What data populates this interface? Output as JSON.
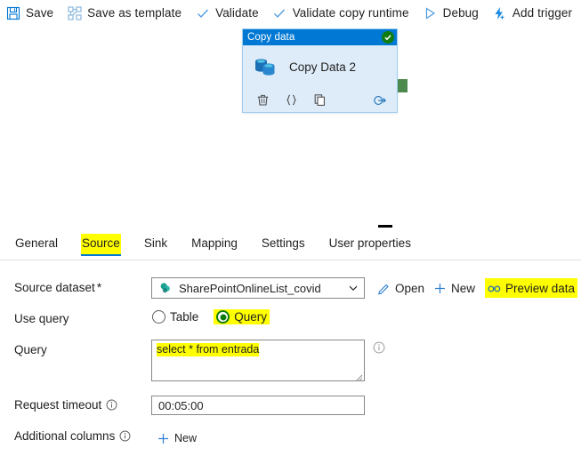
{
  "toolbar": {
    "items": [
      {
        "label": "Save",
        "icon": "save-icon",
        "name": "save-button"
      },
      {
        "label": "Save as template",
        "icon": "save-as-template-icon",
        "name": "save-as-template-button"
      },
      {
        "label": "Validate",
        "icon": "checkmark-icon",
        "name": "validate-button"
      },
      {
        "label": "Validate copy runtime",
        "icon": "checkmark-icon",
        "name": "validate-copy-runtime-button"
      },
      {
        "label": "Debug",
        "icon": "play-triangle-icon",
        "name": "debug-button"
      },
      {
        "label": "Add trigger",
        "icon": "lightning-bolt-plus-icon",
        "name": "add-trigger-button"
      }
    ]
  },
  "canvas": {
    "activity": {
      "header_title": "Copy data",
      "status": "succeeded",
      "name": "Copy Data 2",
      "type_icon": "copy-data-icon",
      "actions": [
        {
          "icon": "trash-icon",
          "name": "delete-activity-button"
        },
        {
          "icon": "code-braces-icon",
          "name": "view-code-button"
        },
        {
          "icon": "copy-icon",
          "name": "clone-activity-button"
        },
        {
          "icon": "add-output-icon",
          "name": "add-output-button"
        }
      ],
      "output_port": "output-connector"
    },
    "collapse_handle": "panel-collapse-handle"
  },
  "tabs": [
    {
      "label": "General",
      "active": false,
      "highlighted": false
    },
    {
      "label": "Source",
      "active": true,
      "highlighted": true
    },
    {
      "label": "Sink",
      "active": false,
      "highlighted": false
    },
    {
      "label": "Mapping",
      "active": false,
      "highlighted": false
    },
    {
      "label": "Settings",
      "active": false,
      "highlighted": false
    },
    {
      "label": "User properties",
      "active": false,
      "highlighted": false
    }
  ],
  "source": {
    "dataset": {
      "label": "Source dataset",
      "required_marker": "*",
      "value": "SharePointOnlineList_covid",
      "icon": "sharepoint-icon",
      "open_label": "Open",
      "new_label": "New",
      "preview_label": "Preview data"
    },
    "use_query": {
      "label": "Use query",
      "options": [
        {
          "label": "Table",
          "checked": false,
          "highlighted": false
        },
        {
          "label": "Query",
          "checked": true,
          "highlighted": true
        }
      ]
    },
    "query": {
      "label": "Query",
      "value": "select * from entrada"
    },
    "request_timeout": {
      "label": "Request timeout",
      "value": "00:05:00"
    },
    "additional_columns": {
      "label": "Additional columns",
      "new_label": "New"
    }
  },
  "colors": {
    "accent": "#0078d4",
    "highlight": "#ffff00",
    "success": "#107c10",
    "node_body": "#deecf9",
    "port": "#4e8a4e"
  }
}
